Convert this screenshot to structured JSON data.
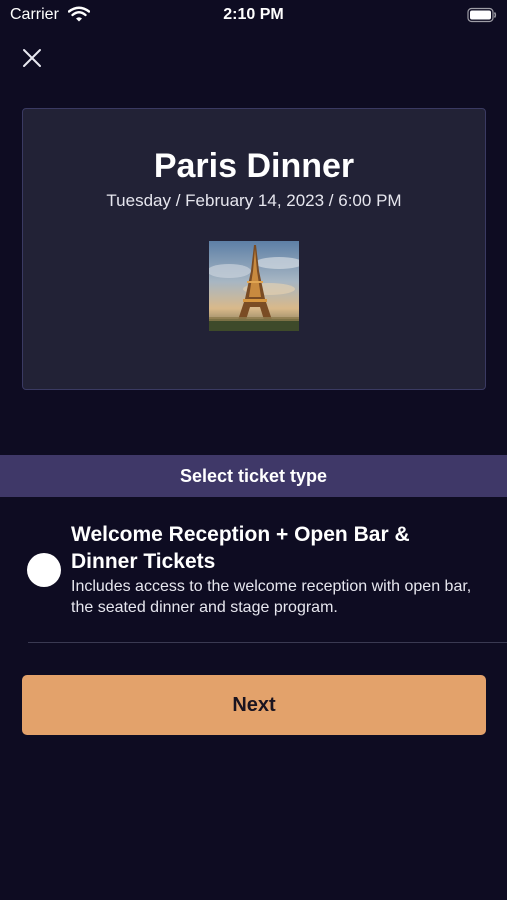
{
  "status_bar": {
    "carrier": "Carrier",
    "time": "2:10 PM",
    "icons": [
      "wifi-icon",
      "battery-icon"
    ]
  },
  "header": {
    "close_icon": "close-icon"
  },
  "event": {
    "title": "Paris Dinner",
    "date": "Tuesday / February 14, 2023 / 6:00 PM",
    "image": "eiffel-tower-thumbnail"
  },
  "ticket_section": {
    "header": "Select ticket type",
    "options": [
      {
        "title": "Welcome Reception + Open Bar & Dinner Tickets",
        "description": "Includes access to the welcome reception with open bar, the seated dinner and stage program.",
        "selected": false
      }
    ]
  },
  "actions": {
    "next_label": "Next"
  },
  "colors": {
    "background": "#0e0c22",
    "card": "#222236",
    "section_header": "#3f3868",
    "accent_button": "#e3a26b"
  }
}
